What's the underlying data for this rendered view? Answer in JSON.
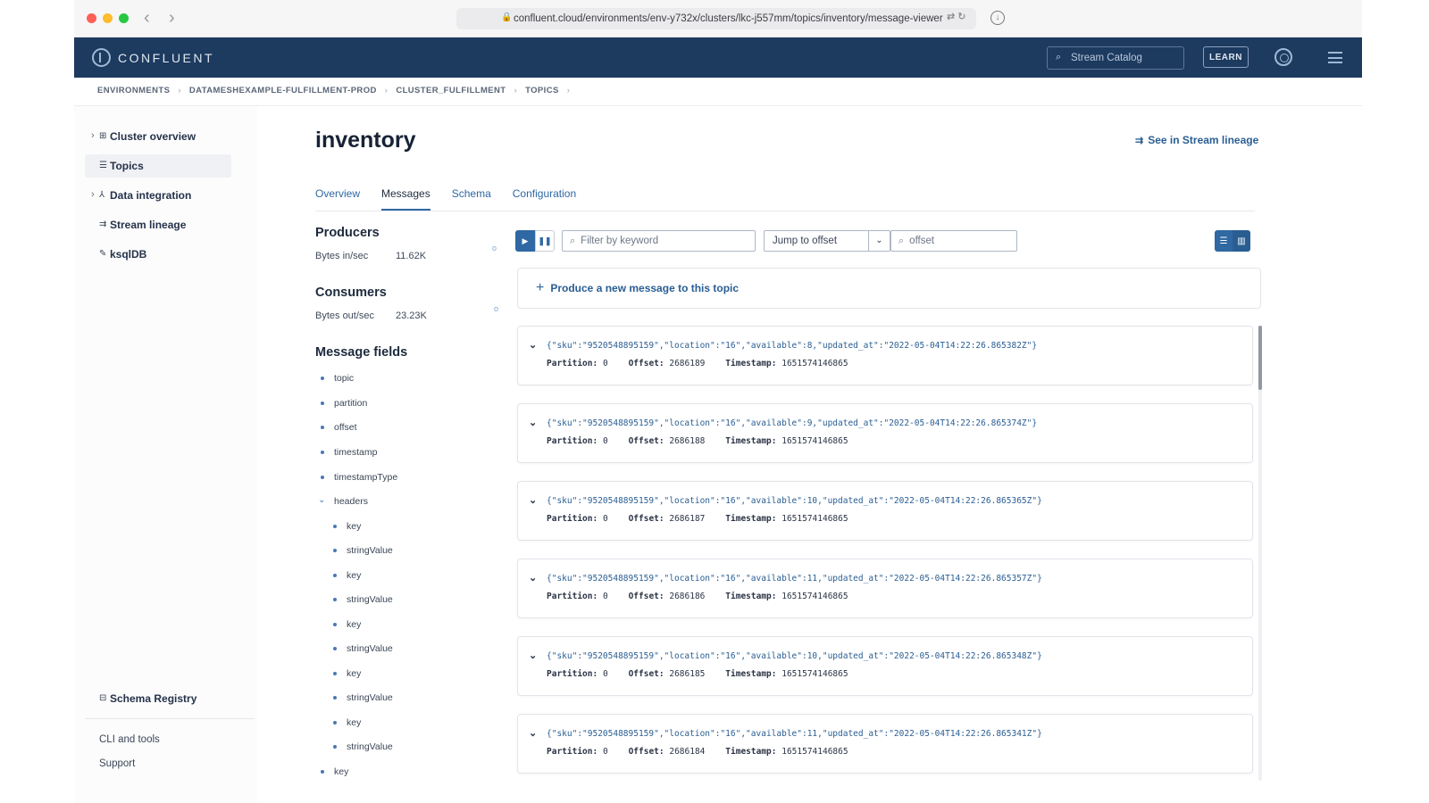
{
  "browser": {
    "url": "confluent.cloud/environments/env-y732x/clusters/lkc-j557mm/topics/inventory/message-viewer"
  },
  "header": {
    "logo_text": "CONFLUENT",
    "search_placeholder": "Stream Catalog",
    "learn_label": "LEARN",
    "icons": [
      "search-icon",
      "help-icon",
      "menu-icon"
    ]
  },
  "breadcrumb": [
    "ENVIRONMENTS",
    "DATAMESHEXAMPLE-FULFILLMENT-PROD",
    "CLUSTER_FULFILLMENT",
    "TOPICS"
  ],
  "sidebar": {
    "items": [
      {
        "label": "Cluster overview",
        "icon": "grid-icon",
        "expandable": true
      },
      {
        "label": "Topics",
        "icon": "topics-icon",
        "active": true
      },
      {
        "label": "Data integration",
        "icon": "integration-icon",
        "expandable": true
      },
      {
        "label": "Stream lineage",
        "icon": "lineage-icon"
      },
      {
        "label": "ksqlDB",
        "icon": "ksqldb-icon"
      }
    ],
    "schema_registry": "Schema Registry",
    "cli_tools": "CLI and tools",
    "support": "Support"
  },
  "page": {
    "title": "inventory",
    "lineage_link": "See in Stream lineage",
    "tabs": [
      "Overview",
      "Messages",
      "Schema",
      "Configuration"
    ],
    "active_tab": "Messages"
  },
  "producers": {
    "heading": "Producers",
    "label": "Bytes in/sec",
    "value": "11.62K"
  },
  "consumers": {
    "heading": "Consumers",
    "label": "Bytes out/sec",
    "value": "23.23K"
  },
  "message_fields": {
    "heading": "Message fields",
    "fields": [
      "topic",
      "partition",
      "offset",
      "timestamp",
      "timestampType"
    ],
    "headers_label": "headers",
    "header_children": [
      "key",
      "stringValue",
      "key",
      "stringValue",
      "key",
      "stringValue",
      "key",
      "stringValue",
      "key",
      "stringValue"
    ],
    "trailing_field": "key"
  },
  "toolbar": {
    "filter_placeholder": "Filter by keyword",
    "jump_label": "Jump to offset",
    "offset_placeholder": "offset"
  },
  "produce_label": "Produce a new message to this topic",
  "messages": [
    {
      "json": "{\"sku\":\"9520548895159\",\"location\":\"16\",\"available\":8,\"updated_at\":\"2022-05-04T14:22:26.865382Z\"}",
      "partition": "0",
      "offset": "2686189",
      "timestamp": "1651574146865"
    },
    {
      "json": "{\"sku\":\"9520548895159\",\"location\":\"16\",\"available\":9,\"updated_at\":\"2022-05-04T14:22:26.865374Z\"}",
      "partition": "0",
      "offset": "2686188",
      "timestamp": "1651574146865"
    },
    {
      "json": "{\"sku\":\"9520548895159\",\"location\":\"16\",\"available\":10,\"updated_at\":\"2022-05-04T14:22:26.865365Z\"}",
      "partition": "0",
      "offset": "2686187",
      "timestamp": "1651574146865"
    },
    {
      "json": "{\"sku\":\"9520548895159\",\"location\":\"16\",\"available\":11,\"updated_at\":\"2022-05-04T14:22:26.865357Z\"}",
      "partition": "0",
      "offset": "2686186",
      "timestamp": "1651574146865"
    },
    {
      "json": "{\"sku\":\"9520548895159\",\"location\":\"16\",\"available\":10,\"updated_at\":\"2022-05-04T14:22:26.865348Z\"}",
      "partition": "0",
      "offset": "2686185",
      "timestamp": "1651574146865"
    },
    {
      "json": "{\"sku\":\"9520548895159\",\"location\":\"16\",\"available\":11,\"updated_at\":\"2022-05-04T14:22:26.865341Z\"}",
      "partition": "0",
      "offset": "2686184",
      "timestamp": "1651574146865"
    }
  ],
  "labels": {
    "partition": "Partition:",
    "offset": "Offset:",
    "timestamp": "Timestamp:"
  },
  "colors": {
    "nav_bg": "#1d3a5f",
    "accent": "#2f68a3"
  }
}
